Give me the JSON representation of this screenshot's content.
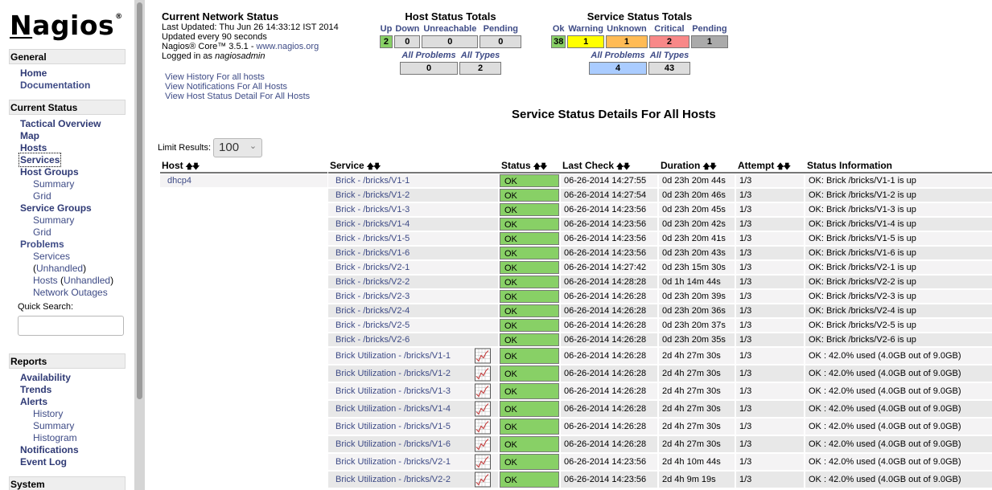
{
  "nav": {
    "logo": {
      "text": "agios",
      "first_letter": "N",
      "mark": "®"
    },
    "sections": {
      "general": "General",
      "current_status": "Current Status",
      "reports": "Reports",
      "system": "System"
    },
    "general_items": [
      "Home",
      "Documentation"
    ],
    "current_status_items": {
      "tactical_overview": "Tactical Overview",
      "map": "Map",
      "hosts": "Hosts",
      "services": "Services",
      "host_groups": "Host Groups",
      "host_groups_summary": "Summary",
      "host_groups_grid": "Grid",
      "service_groups": "Service Groups",
      "service_groups_summary": "Summary",
      "service_groups_grid": "Grid",
      "problems": "Problems",
      "problems_services": "Services",
      "problems_services_unhandled": "Unhandled",
      "problems_hosts": "Hosts",
      "problems_hosts_unhandled": "Unhandled",
      "network_outages": "Network Outages"
    },
    "quick_search": {
      "label": "Quick Search:",
      "value": ""
    },
    "reports_items": {
      "availability": "Availability",
      "trends": "Trends",
      "alerts": "Alerts",
      "alerts_history": "History",
      "alerts_summary": "Summary",
      "alerts_histogram": "Histogram",
      "notifications": "Notifications",
      "event_log": "Event Log"
    },
    "scroll_position": 0.0
  },
  "info": {
    "title": "Current Network Status",
    "last_updated": "Last Updated: Thu Jun 26 14:33:12 IST 2014",
    "update_interval": "Updated every 90 seconds",
    "version_prefix": "Nagios® Core™ 3.5.1 - ",
    "version_link": "www.nagios.org",
    "logged_in_prefix": "Logged in as ",
    "user": "nagiosadmin",
    "links": [
      "View History For all hosts",
      "View Notifications For All Hosts",
      "View Host Status Detail For All Hosts"
    ]
  },
  "host_totals": {
    "title": "Host Status Totals",
    "labels": {
      "up": "Up",
      "down": "Down",
      "unreachable": "Unreachable",
      "pending": "Pending"
    },
    "values": {
      "up": "2",
      "down": "0",
      "unreachable": "0",
      "pending": "0"
    },
    "summary_labels": {
      "all_problems": "All Problems",
      "all_types": "All Types"
    },
    "summary_values": {
      "all_problems": "0",
      "all_types": "2"
    }
  },
  "service_totals": {
    "title": "Service Status Totals",
    "labels": {
      "ok": "Ok",
      "warning": "Warning",
      "unknown": "Unknown",
      "critical": "Critical",
      "pending": "Pending"
    },
    "values": {
      "ok": "38",
      "warning": "1",
      "unknown": "1",
      "critical": "2",
      "pending": "1"
    },
    "summary_labels": {
      "all_problems": "All Problems",
      "all_types": "All Types"
    },
    "summary_values": {
      "all_problems": "4",
      "all_types": "43"
    }
  },
  "colors": {
    "ok": "#88d066",
    "warning": "#ffff00",
    "unknown": "#ffbb55",
    "critical": "#f88888",
    "pending": "#aaaaaa",
    "problems": "#aaccff",
    "neutral": "#dddddd",
    "link": "#3e4b86"
  },
  "page_title": "Service Status Details For All Hosts",
  "limit": {
    "label": "Limit Results:",
    "value": "100"
  },
  "table": {
    "headers": {
      "host": "Host",
      "service": "Service",
      "status": "Status",
      "last_check": "Last Check",
      "duration": "Duration",
      "attempt": "Attempt",
      "status_info": "Status Information"
    },
    "host": "dhcp4",
    "rows": [
      {
        "service": "Brick - /bricks/V1-1",
        "status": "OK",
        "last_check": "06-26-2014 14:27:55",
        "duration": "0d 23h 20m 44s",
        "attempt": "1/3",
        "info": "OK: Brick /bricks/V1-1 is up",
        "graph": false
      },
      {
        "service": "Brick - /bricks/V1-2",
        "status": "OK",
        "last_check": "06-26-2014 14:27:54",
        "duration": "0d 23h 20m 46s",
        "attempt": "1/3",
        "info": "OK: Brick /bricks/V1-2 is up",
        "graph": false
      },
      {
        "service": "Brick - /bricks/V1-3",
        "status": "OK",
        "last_check": "06-26-2014 14:23:56",
        "duration": "0d 23h 20m 45s",
        "attempt": "1/3",
        "info": "OK: Brick /bricks/V1-3 is up",
        "graph": false
      },
      {
        "service": "Brick - /bricks/V1-4",
        "status": "OK",
        "last_check": "06-26-2014 14:23:56",
        "duration": "0d 23h 20m 42s",
        "attempt": "1/3",
        "info": "OK: Brick /bricks/V1-4 is up",
        "graph": false
      },
      {
        "service": "Brick - /bricks/V1-5",
        "status": "OK",
        "last_check": "06-26-2014 14:23:56",
        "duration": "0d 23h 20m 41s",
        "attempt": "1/3",
        "info": "OK: Brick /bricks/V1-5 is up",
        "graph": false
      },
      {
        "service": "Brick - /bricks/V1-6",
        "status": "OK",
        "last_check": "06-26-2014 14:23:56",
        "duration": "0d 23h 20m 43s",
        "attempt": "1/3",
        "info": "OK: Brick /bricks/V1-6 is up",
        "graph": false
      },
      {
        "service": "Brick - /bricks/V2-1",
        "status": "OK",
        "last_check": "06-26-2014 14:27:42",
        "duration": "0d 23h 15m 30s",
        "attempt": "1/3",
        "info": "OK: Brick /bricks/V2-1 is up",
        "graph": false
      },
      {
        "service": "Brick - /bricks/V2-2",
        "status": "OK",
        "last_check": "06-26-2014 14:28:28",
        "duration": "0d 1h 14m 44s",
        "attempt": "1/3",
        "info": "OK: Brick /bricks/V2-2 is up",
        "graph": false
      },
      {
        "service": "Brick - /bricks/V2-3",
        "status": "OK",
        "last_check": "06-26-2014 14:26:28",
        "duration": "0d 23h 20m 39s",
        "attempt": "1/3",
        "info": "OK: Brick /bricks/V2-3 is up",
        "graph": false
      },
      {
        "service": "Brick - /bricks/V2-4",
        "status": "OK",
        "last_check": "06-26-2014 14:26:28",
        "duration": "0d 23h 20m 36s",
        "attempt": "1/3",
        "info": "OK: Brick /bricks/V2-4 is up",
        "graph": false
      },
      {
        "service": "Brick - /bricks/V2-5",
        "status": "OK",
        "last_check": "06-26-2014 14:26:28",
        "duration": "0d 23h 20m 37s",
        "attempt": "1/3",
        "info": "OK: Brick /bricks/V2-5 is up",
        "graph": false
      },
      {
        "service": "Brick - /bricks/V2-6",
        "status": "OK",
        "last_check": "06-26-2014 14:26:28",
        "duration": "0d 23h 20m 35s",
        "attempt": "1/3",
        "info": "OK: Brick /bricks/V2-6 is up",
        "graph": false
      },
      {
        "service": "Brick Utilization - /bricks/V1-1",
        "status": "OK",
        "last_check": "06-26-2014 14:26:28",
        "duration": "2d 4h 27m 30s",
        "attempt": "1/3",
        "info": "OK : 42.0% used (4.0GB out of 9.0GB)",
        "graph": true
      },
      {
        "service": "Brick Utilization - /bricks/V1-2",
        "status": "OK",
        "last_check": "06-26-2014 14:26:28",
        "duration": "2d 4h 27m 30s",
        "attempt": "1/3",
        "info": "OK : 42.0% used (4.0GB out of 9.0GB)",
        "graph": true
      },
      {
        "service": "Brick Utilization - /bricks/V1-3",
        "status": "OK",
        "last_check": "06-26-2014 14:26:28",
        "duration": "2d 4h 27m 30s",
        "attempt": "1/3",
        "info": "OK : 42.0% used (4.0GB out of 9.0GB)",
        "graph": true
      },
      {
        "service": "Brick Utilization - /bricks/V1-4",
        "status": "OK",
        "last_check": "06-26-2014 14:26:28",
        "duration": "2d 4h 27m 30s",
        "attempt": "1/3",
        "info": "OK : 42.0% used (4.0GB out of 9.0GB)",
        "graph": true
      },
      {
        "service": "Brick Utilization - /bricks/V1-5",
        "status": "OK",
        "last_check": "06-26-2014 14:26:28",
        "duration": "2d 4h 27m 30s",
        "attempt": "1/3",
        "info": "OK : 42.0% used (4.0GB out of 9.0GB)",
        "graph": true
      },
      {
        "service": "Brick Utilization - /bricks/V1-6",
        "status": "OK",
        "last_check": "06-26-2014 14:26:28",
        "duration": "2d 4h 27m 30s",
        "attempt": "1/3",
        "info": "OK : 42.0% used (4.0GB out of 9.0GB)",
        "graph": true
      },
      {
        "service": "Brick Utilization - /bricks/V2-1",
        "status": "OK",
        "last_check": "06-26-2014 14:23:56",
        "duration": "2d 4h 10m 44s",
        "attempt": "1/3",
        "info": "OK : 42.0% used (4.0GB out of 9.0GB)",
        "graph": true
      },
      {
        "service": "Brick Utilization - /bricks/V2-2",
        "status": "OK",
        "last_check": "06-26-2014 14:23:56",
        "duration": "2d 4h 9m 19s",
        "attempt": "1/3",
        "info": "OK : 42.0% used (4.0GB out of 9.0GB)",
        "graph": true
      }
    ]
  }
}
